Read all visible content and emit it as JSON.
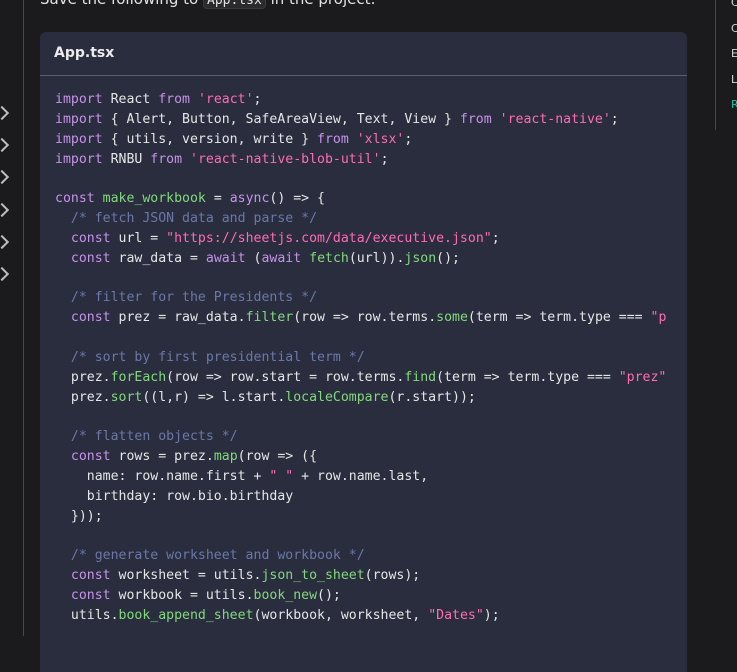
{
  "intro": {
    "before": "Save the following to ",
    "filename": "App.tsx",
    "after": " in the project:"
  },
  "code_block": {
    "title": "App.tsx",
    "lines": [
      [
        [
          "kw",
          "import"
        ],
        [
          "p",
          " React "
        ],
        [
          "kw",
          "from"
        ],
        [
          "p",
          " "
        ],
        [
          "str",
          "'react'"
        ],
        [
          "p",
          ";"
        ]
      ],
      [
        [
          "kw",
          "import"
        ],
        [
          "p",
          " { Alert, Button, SafeAreaView, Text, View } "
        ],
        [
          "kw",
          "from"
        ],
        [
          "p",
          " "
        ],
        [
          "str",
          "'react-native'"
        ],
        [
          "p",
          ";"
        ]
      ],
      [
        [
          "kw",
          "import"
        ],
        [
          "p",
          " { utils, version, write } "
        ],
        [
          "kw",
          "from"
        ],
        [
          "p",
          " "
        ],
        [
          "str",
          "'xlsx'"
        ],
        [
          "p",
          ";"
        ]
      ],
      [
        [
          "kw",
          "import"
        ],
        [
          "p",
          " RNBU "
        ],
        [
          "kw",
          "from"
        ],
        [
          "p",
          " "
        ],
        [
          "str",
          "'react-native-blob-util'"
        ],
        [
          "p",
          ";"
        ]
      ],
      [],
      [
        [
          "kw",
          "const"
        ],
        [
          "p",
          " "
        ],
        [
          "fn",
          "make_workbook"
        ],
        [
          "p",
          " = "
        ],
        [
          "kw",
          "async"
        ],
        [
          "p",
          "() => {"
        ]
      ],
      [
        [
          "p",
          "  "
        ],
        [
          "cm",
          "/* fetch JSON data and parse */"
        ]
      ],
      [
        [
          "p",
          "  "
        ],
        [
          "kw",
          "const"
        ],
        [
          "p",
          " url = "
        ],
        [
          "str",
          "\"https://sheetjs.com/data/executive.json\""
        ],
        [
          "p",
          ";"
        ]
      ],
      [
        [
          "p",
          "  "
        ],
        [
          "kw",
          "const"
        ],
        [
          "p",
          " raw_data = "
        ],
        [
          "kw",
          "await"
        ],
        [
          "p",
          " ("
        ],
        [
          "kw",
          "await"
        ],
        [
          "p",
          " "
        ],
        [
          "fn",
          "fetch"
        ],
        [
          "p",
          "(url))."
        ],
        [
          "fn",
          "json"
        ],
        [
          "p",
          "();"
        ]
      ],
      [],
      [
        [
          "p",
          "  "
        ],
        [
          "cm",
          "/* filter for the Presidents */"
        ]
      ],
      [
        [
          "p",
          "  "
        ],
        [
          "kw",
          "const"
        ],
        [
          "p",
          " prez = raw_data."
        ],
        [
          "fn",
          "filter"
        ],
        [
          "p",
          "(row => row.terms."
        ],
        [
          "fn",
          "some"
        ],
        [
          "p",
          "(term => term.type === "
        ],
        [
          "str",
          "\"p"
        ]
      ],
      [],
      [
        [
          "p",
          "  "
        ],
        [
          "cm",
          "/* sort by first presidential term */"
        ]
      ],
      [
        [
          "p",
          "  prez."
        ],
        [
          "fn",
          "forEach"
        ],
        [
          "p",
          "(row => row.start = row.terms."
        ],
        [
          "fn",
          "find"
        ],
        [
          "p",
          "(term => term.type === "
        ],
        [
          "str",
          "\"prez\""
        ]
      ],
      [
        [
          "p",
          "  prez."
        ],
        [
          "fn",
          "sort"
        ],
        [
          "p",
          "((l,r) => l.start."
        ],
        [
          "fn",
          "localeCompare"
        ],
        [
          "p",
          "(r.start));"
        ]
      ],
      [],
      [
        [
          "p",
          "  "
        ],
        [
          "cm",
          "/* flatten objects */"
        ]
      ],
      [
        [
          "p",
          "  "
        ],
        [
          "kw",
          "const"
        ],
        [
          "p",
          " rows = prez."
        ],
        [
          "fn",
          "map"
        ],
        [
          "p",
          "(row => ({"
        ]
      ],
      [
        [
          "p",
          "    name: row.name.first + "
        ],
        [
          "str",
          "\" \""
        ],
        [
          "p",
          " + row.name.last,"
        ]
      ],
      [
        [
          "p",
          "    birthday: row.bio.birthday"
        ]
      ],
      [
        [
          "p",
          "  }));"
        ]
      ],
      [],
      [
        [
          "p",
          "  "
        ],
        [
          "cm",
          "/* generate worksheet and workbook */"
        ]
      ],
      [
        [
          "p",
          "  "
        ],
        [
          "kw",
          "const"
        ],
        [
          "p",
          " worksheet = utils."
        ],
        [
          "fn",
          "json_to_sheet"
        ],
        [
          "p",
          "(rows);"
        ]
      ],
      [
        [
          "p",
          "  "
        ],
        [
          "kw",
          "const"
        ],
        [
          "p",
          " workbook = utils."
        ],
        [
          "fn",
          "book_new"
        ],
        [
          "p",
          "();"
        ]
      ],
      [
        [
          "p",
          "  utils."
        ],
        [
          "fn",
          "book_append_sheet"
        ],
        [
          "p",
          "(workbook, worksheet, "
        ],
        [
          "str",
          "\"Dates\""
        ],
        [
          "p",
          ");"
        ]
      ]
    ]
  },
  "toc": {
    "items": [
      {
        "label": "C",
        "active": false
      },
      {
        "label": "C",
        "active": false
      },
      {
        "label": "E",
        "active": false
      },
      {
        "label": "L",
        "active": false
      },
      {
        "label": "R",
        "active": true
      }
    ]
  },
  "colors": {
    "keyword": "#c792ea",
    "string": "#ff6bb5",
    "function": "#82d97b",
    "comment": "#6b78a8",
    "toc_active": "#25c2a0"
  }
}
